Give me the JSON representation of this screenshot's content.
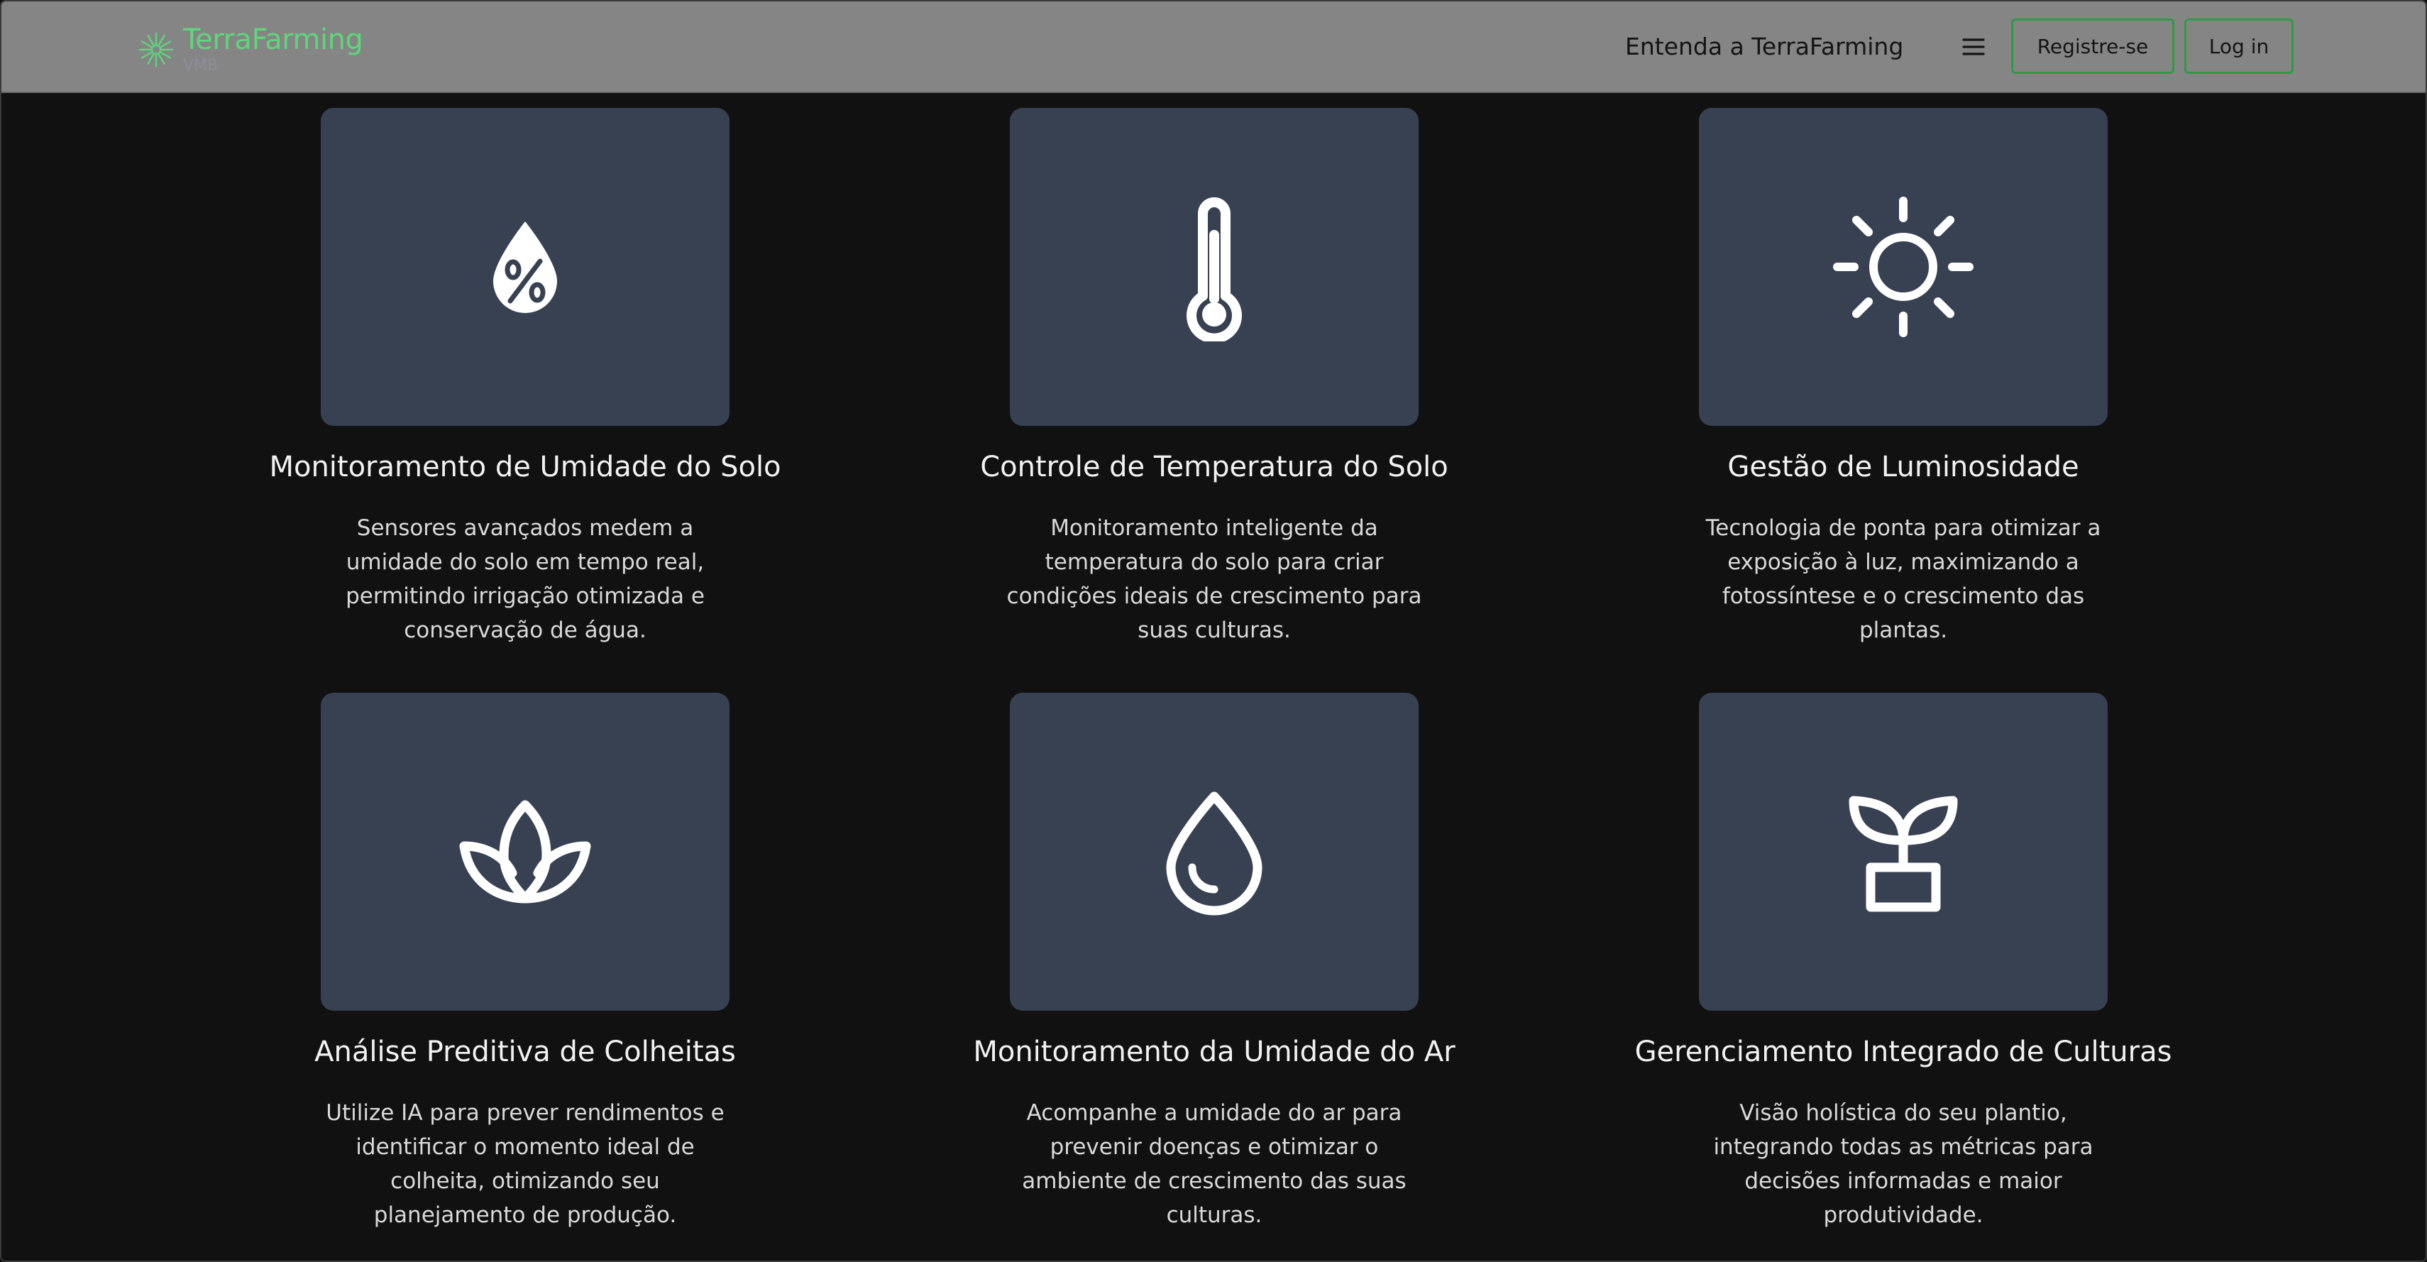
{
  "header": {
    "brand_title": "TerraFarming",
    "brand_subtitle": "VMB",
    "nav_link": "Entenda a TerraFarming",
    "register_label": "Registre-se",
    "login_label": "Log in",
    "colors": {
      "header_bg": "#858585",
      "brand": "#5ed67a",
      "button_border": "#2f9a45"
    }
  },
  "features": [
    {
      "icon": "percent-drop-icon",
      "title": "Monitoramento de Umidade do Solo",
      "lines": [
        "Sensores avançados medem a",
        "umidade do solo em tempo real,",
        "permitindo irrigação otimizada e",
        "conservação de água."
      ]
    },
    {
      "icon": "thermometer-icon",
      "title": "Controle de Temperatura do Solo",
      "lines": [
        "Monitoramento inteligente da",
        "temperatura do solo para criar",
        "condições ideais de crescimento para",
        "suas culturas."
      ]
    },
    {
      "icon": "sun-icon",
      "title": "Gestão de Luminosidade",
      "lines": [
        "Tecnologia de ponta para otimizar a",
        "exposição à luz, maximizando a",
        "fotossíntese e o crescimento das",
        "plantas."
      ]
    },
    {
      "icon": "lotus-icon",
      "title": "Análise Preditiva de Colheitas",
      "lines": [
        "Utilize IA para prever rendimentos e",
        "identificar o momento ideal de",
        "colheita, otimizando seu",
        "planejamento de produção."
      ]
    },
    {
      "icon": "droplet-icon",
      "title": "Monitoramento da Umidade do Ar",
      "lines": [
        "Acompanhe a umidade do ar para",
        "prevenir doenças e otimizar o",
        "ambiente de crescimento das suas",
        "culturas."
      ]
    },
    {
      "icon": "potted-plant-icon",
      "title": "Gerenciamento Integrado de Culturas",
      "lines": [
        "Visão holística do seu plantio,",
        "integrando todas as métricas para",
        "decisões informadas e maior",
        "produtividade."
      ]
    }
  ],
  "colors": {
    "page_bg": "#111111",
    "card_bg": "#374151",
    "icon": "#ffffff"
  }
}
